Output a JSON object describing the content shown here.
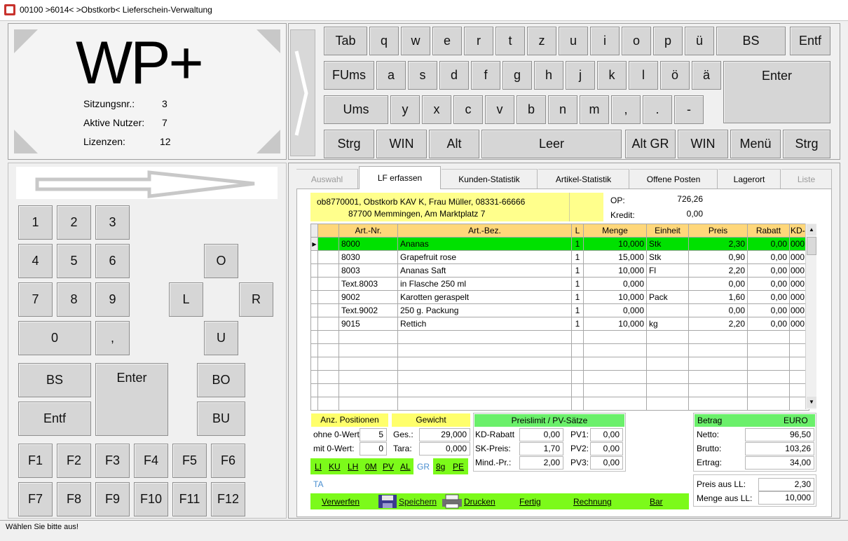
{
  "window": {
    "title": "00100 >6014< >Obstkorb< Lieferschein-Verwaltung"
  },
  "logo": {
    "text": "WP+"
  },
  "session": {
    "rows": [
      {
        "label": "Sitzungsnr.:",
        "value": "3"
      },
      {
        "label": "Aktive Nutzer:",
        "value": "7"
      },
      {
        "label": "Lizenzen:",
        "value": "12"
      }
    ]
  },
  "keyboard": {
    "row1": [
      "Tab",
      "q",
      "w",
      "e",
      "r",
      "t",
      "z",
      "u",
      "i",
      "o",
      "p",
      "ü",
      "BS",
      "Entf"
    ],
    "row2": [
      "FUms",
      "a",
      "s",
      "d",
      "f",
      "g",
      "h",
      "j",
      "k",
      "l",
      "ö",
      "ä",
      "Enter"
    ],
    "row3": [
      "Ums",
      "y",
      "x",
      "c",
      "v",
      "b",
      "n",
      "m",
      ",",
      ".",
      "-"
    ],
    "row4": [
      "Strg",
      "WIN",
      "Alt",
      "Leer",
      "Alt GR",
      "WIN",
      "Menü",
      "Strg"
    ]
  },
  "numpad": {
    "digits": [
      "1",
      "2",
      "3",
      "4",
      "5",
      "6",
      "7",
      "8",
      "9",
      "0",
      ","
    ],
    "nav": {
      "o": "O",
      "l": "L",
      "r": "R",
      "u": "U"
    },
    "bs": "BS",
    "enter": "Enter",
    "entf": "Entf",
    "bo": "BO",
    "bu": "BU",
    "fkeys": [
      "F1",
      "F2",
      "F3",
      "F4",
      "F5",
      "F6",
      "F7",
      "F8",
      "F9",
      "F10",
      "F11",
      "F12"
    ]
  },
  "tabs": [
    {
      "label": "Auswahl",
      "state": "disabled"
    },
    {
      "label": "LF erfassen",
      "state": "active"
    },
    {
      "label": "Kunden-Statistik",
      "state": "normal"
    },
    {
      "label": "Artikel-Statistik",
      "state": "normal"
    },
    {
      "label": "Offene Posten",
      "state": "normal"
    },
    {
      "label": "Lagerort",
      "state": "normal"
    },
    {
      "label": "Liste",
      "state": "disabled"
    }
  ],
  "customer": {
    "line1": "ob8770001,  Obstkorb  KAV K,  Frau Müller,  08331-66666",
    "line2": "87700  Memmingen,  Am Marktplatz 7",
    "op_label": "OP:",
    "op_value": "726,26",
    "kredit_label": "Kredit:",
    "kredit_value": "0,00"
  },
  "grid": {
    "columns": [
      "",
      "Art.-Nr.",
      "Art.-Bez.",
      "L",
      "Menge",
      "Einheit",
      "Preis",
      "Rabatt",
      "KD-"
    ],
    "rows": [
      {
        "selected": true,
        "cells": [
          "",
          "8000",
          "Ananas",
          "1",
          "10,000",
          "Stk",
          "2,30",
          "0,00",
          "000"
        ]
      },
      {
        "selected": false,
        "cells": [
          "",
          "8030",
          "Grapefruit rose",
          "1",
          "15,000",
          "Stk",
          "0,90",
          "0,00",
          "000"
        ]
      },
      {
        "selected": false,
        "cells": [
          "",
          "8003",
          "Ananas Saft",
          "1",
          "10,000",
          "Fl",
          "2,20",
          "0,00",
          "000"
        ]
      },
      {
        "selected": false,
        "cells": [
          "",
          "Text.8003",
          "in Flasche 250 ml",
          "1",
          "0,000",
          "",
          "0,00",
          "0,00",
          "000"
        ]
      },
      {
        "selected": false,
        "cells": [
          "",
          "9002",
          "Karotten geraspelt",
          "1",
          "10,000",
          "Pack",
          "1,60",
          "0,00",
          "000"
        ]
      },
      {
        "selected": false,
        "cells": [
          "",
          "Text.9002",
          "250 g. Packung",
          "1",
          "0,000",
          "",
          "0,00",
          "0,00",
          "000"
        ]
      },
      {
        "selected": false,
        "cells": [
          "",
          "9015",
          "Rettich",
          "1",
          "10,000",
          "kg",
          "2,20",
          "0,00",
          "000"
        ]
      },
      {
        "selected": false,
        "cells": [
          "",
          "",
          "",
          "",
          "",
          "",
          "",
          "",
          ""
        ]
      },
      {
        "selected": false,
        "cells": [
          "",
          "",
          "",
          "",
          "",
          "",
          "",
          "",
          ""
        ]
      },
      {
        "selected": false,
        "cells": [
          "",
          "",
          "",
          "",
          "",
          "",
          "",
          "",
          ""
        ]
      },
      {
        "selected": false,
        "cells": [
          "",
          "",
          "",
          "",
          "",
          "",
          "",
          "",
          ""
        ]
      },
      {
        "selected": false,
        "cells": [
          "",
          "",
          "",
          "",
          "",
          "",
          "",
          "",
          ""
        ]
      },
      {
        "selected": false,
        "cells": [
          "",
          "",
          "",
          "",
          "",
          "",
          "",
          "",
          ""
        ]
      }
    ]
  },
  "positionen": {
    "title": "Anz. Positionen",
    "ohne_label": "ohne 0-Wert",
    "ohne_value": "5",
    "mit_label": "mit 0-Wert:",
    "mit_value": "0"
  },
  "gewicht": {
    "title": "Gewicht",
    "ges_label": "Ges.:",
    "ges_value": "29,000",
    "tara_label": "Tara:",
    "tara_value": "0,000"
  },
  "preislimit": {
    "title": "Preislimit / PV-Sätze",
    "kd_label": "KD-Rabatt",
    "kd_value": "0,00",
    "sk_label": "SK-Preis:",
    "sk_value": "1,70",
    "mind_label": "Mind.-Pr.:",
    "mind_value": "2,00",
    "pv1_label": "PV1:",
    "pv1_value": "0,00",
    "pv2_label": "PV2:",
    "pv2_value": "0,00",
    "pv3_label": "PV3:",
    "pv3_value": "0,00"
  },
  "betrag": {
    "title": "Betrag",
    "currency": "EURO",
    "netto_label": "Netto:",
    "netto_value": "96,50",
    "brutto_label": "Brutto:",
    "brutto_value": "103,26",
    "ertrag_label": "Ertrag:",
    "ertrag_value": "34,00"
  },
  "ll": {
    "preis_label": "Preis aus LL:",
    "preis_value": "2,30",
    "menge_label": "Menge aus LL:",
    "menge_value": "10,000"
  },
  "shortcuts": [
    "LI",
    "KU",
    "LH",
    "0M",
    "PV",
    "AL",
    "GR",
    "8g",
    "PE"
  ],
  "ta_label": "TA",
  "actions": {
    "verwerfen": "Verwerfen",
    "speichern": "Speichern",
    "drucken": "Drucken",
    "fertig": "Fertig",
    "rechnung": "Rechnung",
    "bar": "Bar"
  },
  "status": {
    "text": "Wählen Sie bitte aus!"
  },
  "colors": {
    "accent_green": "#00e100",
    "header_yellow": "#ffff6b",
    "header_orange": "#ffd77a",
    "bar_green": "#7cfa1a"
  }
}
